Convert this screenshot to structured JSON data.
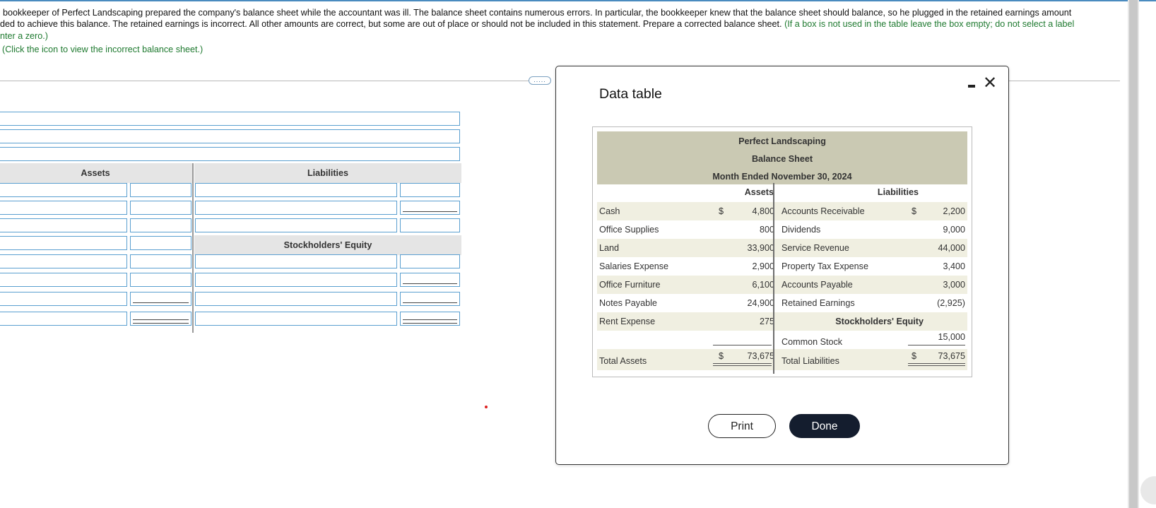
{
  "problem": {
    "line1": "bookkeeper of Perfect Landscaping prepared the company's balance sheet while the accountant was ill. The balance sheet contains numerous errors. In particular, the bookkeeper knew that the balance sheet should balance, so he plugged in the retained earnings amount",
    "line2_black": "ded to achieve this balance. The retained earnings is incorrect. All other amounts are correct, but some are out of place or should not be included in this statement. Prepare a corrected balance sheet.",
    "line2_green": "(If a box is not used in the table leave the box empty; do not select a label",
    "line3_green": "nter a zero.)",
    "click_link": "(Click the icon to view the incorrect balance sheet.)",
    "expand_label": "....."
  },
  "form": {
    "assets_header": "Assets",
    "liabilities_header": "Liabilities",
    "equity_header": "Stockholders' Equity"
  },
  "modal": {
    "title": "Data table",
    "minimize_label": "",
    "close_label": "✕",
    "company": "Perfect Landscaping",
    "statement": "Balance Sheet",
    "period": "Month Ended November 30, 2024",
    "assets_header": "Assets",
    "liabilities_header": "Liabilities",
    "equity_header": "Stockholders' Equity",
    "assets": [
      {
        "label": "Cash",
        "dollar": "$",
        "amount": "4,800"
      },
      {
        "label": "Office Supplies",
        "dollar": "",
        "amount": "800"
      },
      {
        "label": "Land",
        "dollar": "",
        "amount": "33,900"
      },
      {
        "label": "Salaries Expense",
        "dollar": "",
        "amount": "2,900"
      },
      {
        "label": "Office Furniture",
        "dollar": "",
        "amount": "6,100"
      },
      {
        "label": "Notes Payable",
        "dollar": "",
        "amount": "24,900"
      },
      {
        "label": "Rent Expense",
        "dollar": "",
        "amount": "275"
      }
    ],
    "liabilities": [
      {
        "label": "Accounts Receivable",
        "dollar": "$",
        "amount": "2,200"
      },
      {
        "label": "Dividends",
        "dollar": "",
        "amount": "9,000"
      },
      {
        "label": "Service Revenue",
        "dollar": "",
        "amount": "44,000"
      },
      {
        "label": "Property Tax Expense",
        "dollar": "",
        "amount": "3,400"
      },
      {
        "label": "Accounts Payable",
        "dollar": "",
        "amount": "3,000"
      },
      {
        "label": "Retained Earnings",
        "dollar": "",
        "amount": "(2,925)"
      }
    ],
    "common_stock": {
      "label": "Common Stock",
      "amount": "15,000"
    },
    "total_assets": {
      "label": "Total Assets",
      "dollar": "$",
      "amount": "73,675"
    },
    "total_liabilities": {
      "label": "Total Liabilities",
      "dollar": "$",
      "amount": "73,675"
    },
    "print_label": "Print",
    "done_label": "Done"
  }
}
